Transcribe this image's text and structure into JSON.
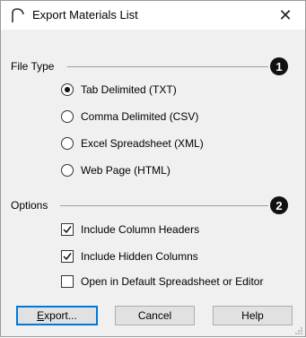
{
  "window": {
    "title": "Export Materials List",
    "close_glyph": "✕"
  },
  "file_type": {
    "label": "File Type",
    "badge": "1",
    "options": [
      {
        "label": "Tab Delimited (TXT)",
        "selected": true
      },
      {
        "label": "Comma Delimited (CSV)",
        "selected": false
      },
      {
        "label": "Excel Spreadsheet (XML)",
        "selected": false
      },
      {
        "label": "Web Page (HTML)",
        "selected": false
      }
    ]
  },
  "options": {
    "label": "Options",
    "badge": "2",
    "items": [
      {
        "label": "Include Column Headers",
        "checked": true
      },
      {
        "label": "Include Hidden Columns",
        "checked": true
      },
      {
        "label": "Open in Default Spreadsheet or Editor",
        "checked": false
      }
    ]
  },
  "buttons": {
    "export": {
      "mnemonic": "E",
      "rest": "xport..."
    },
    "cancel": "Cancel",
    "help": "Help"
  },
  "colors": {
    "accent": "#0078d7",
    "badge": "#111111"
  }
}
